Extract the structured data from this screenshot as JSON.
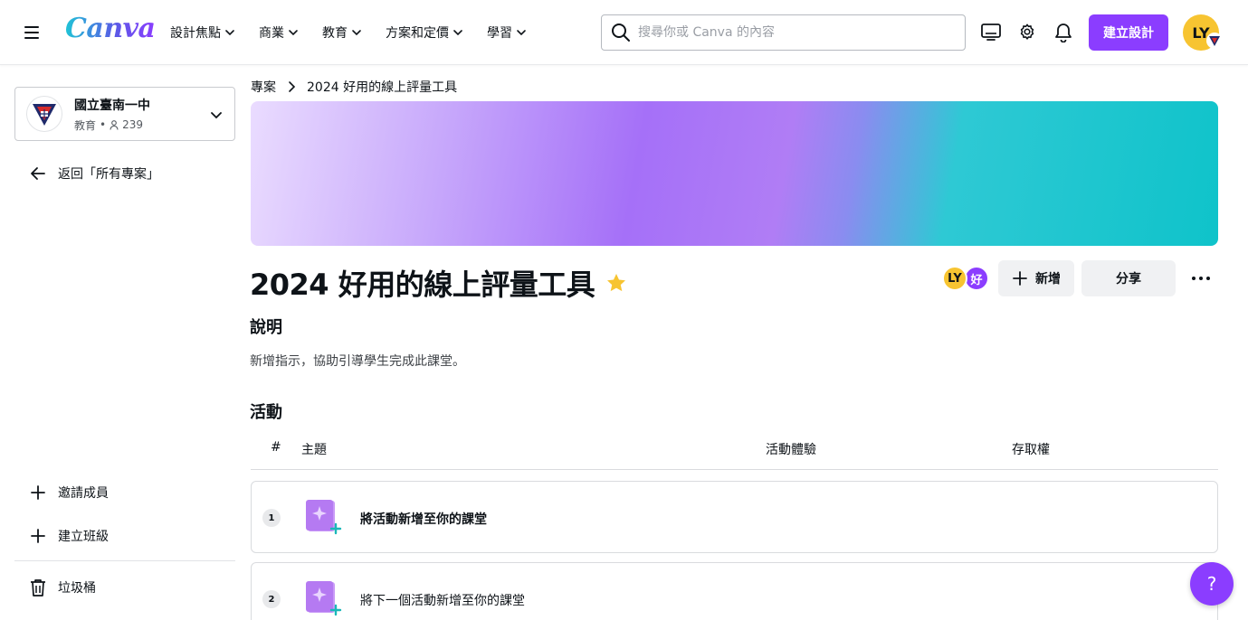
{
  "header": {
    "logo": "Canva",
    "nav": [
      {
        "label": "設計焦點"
      },
      {
        "label": "商業"
      },
      {
        "label": "教育"
      },
      {
        "label": "方案和定價"
      },
      {
        "label": "學習"
      }
    ],
    "search_placeholder": "搜尋你或 Canva 的內容",
    "create_label": "建立設計",
    "avatar_initials": "LY"
  },
  "sidebar": {
    "team_name": "國立臺南一中",
    "team_type": "教育",
    "team_members": "239",
    "back_label": "返回「所有專案」",
    "invite_label": "邀請成員",
    "create_class_label": "建立班級",
    "trash_label": "垃圾桶"
  },
  "main": {
    "breadcrumb_root": "專案",
    "breadcrumb_current": "2024 好用的線上評量工具",
    "title": "2024 好用的線上評量工具",
    "collaborators": [
      "LY",
      "好"
    ],
    "add_label": "新增",
    "share_label": "分享",
    "description_heading": "說明",
    "description_text": "新增指示，協助引導學生完成此課堂。",
    "activities_heading": "活動",
    "columns": {
      "num": "#",
      "topic": "主題",
      "experience": "活動體驗",
      "access": "存取權"
    },
    "activities": [
      {
        "num": "1",
        "label": "將活動新增至你的課堂"
      },
      {
        "num": "2",
        "label": "將下一個活動新增至你的課堂"
      }
    ],
    "help_label": "?"
  },
  "colors": {
    "accent": "#8b3dff",
    "avatar": "#f7c431",
    "teal": "#0fc3ca"
  }
}
